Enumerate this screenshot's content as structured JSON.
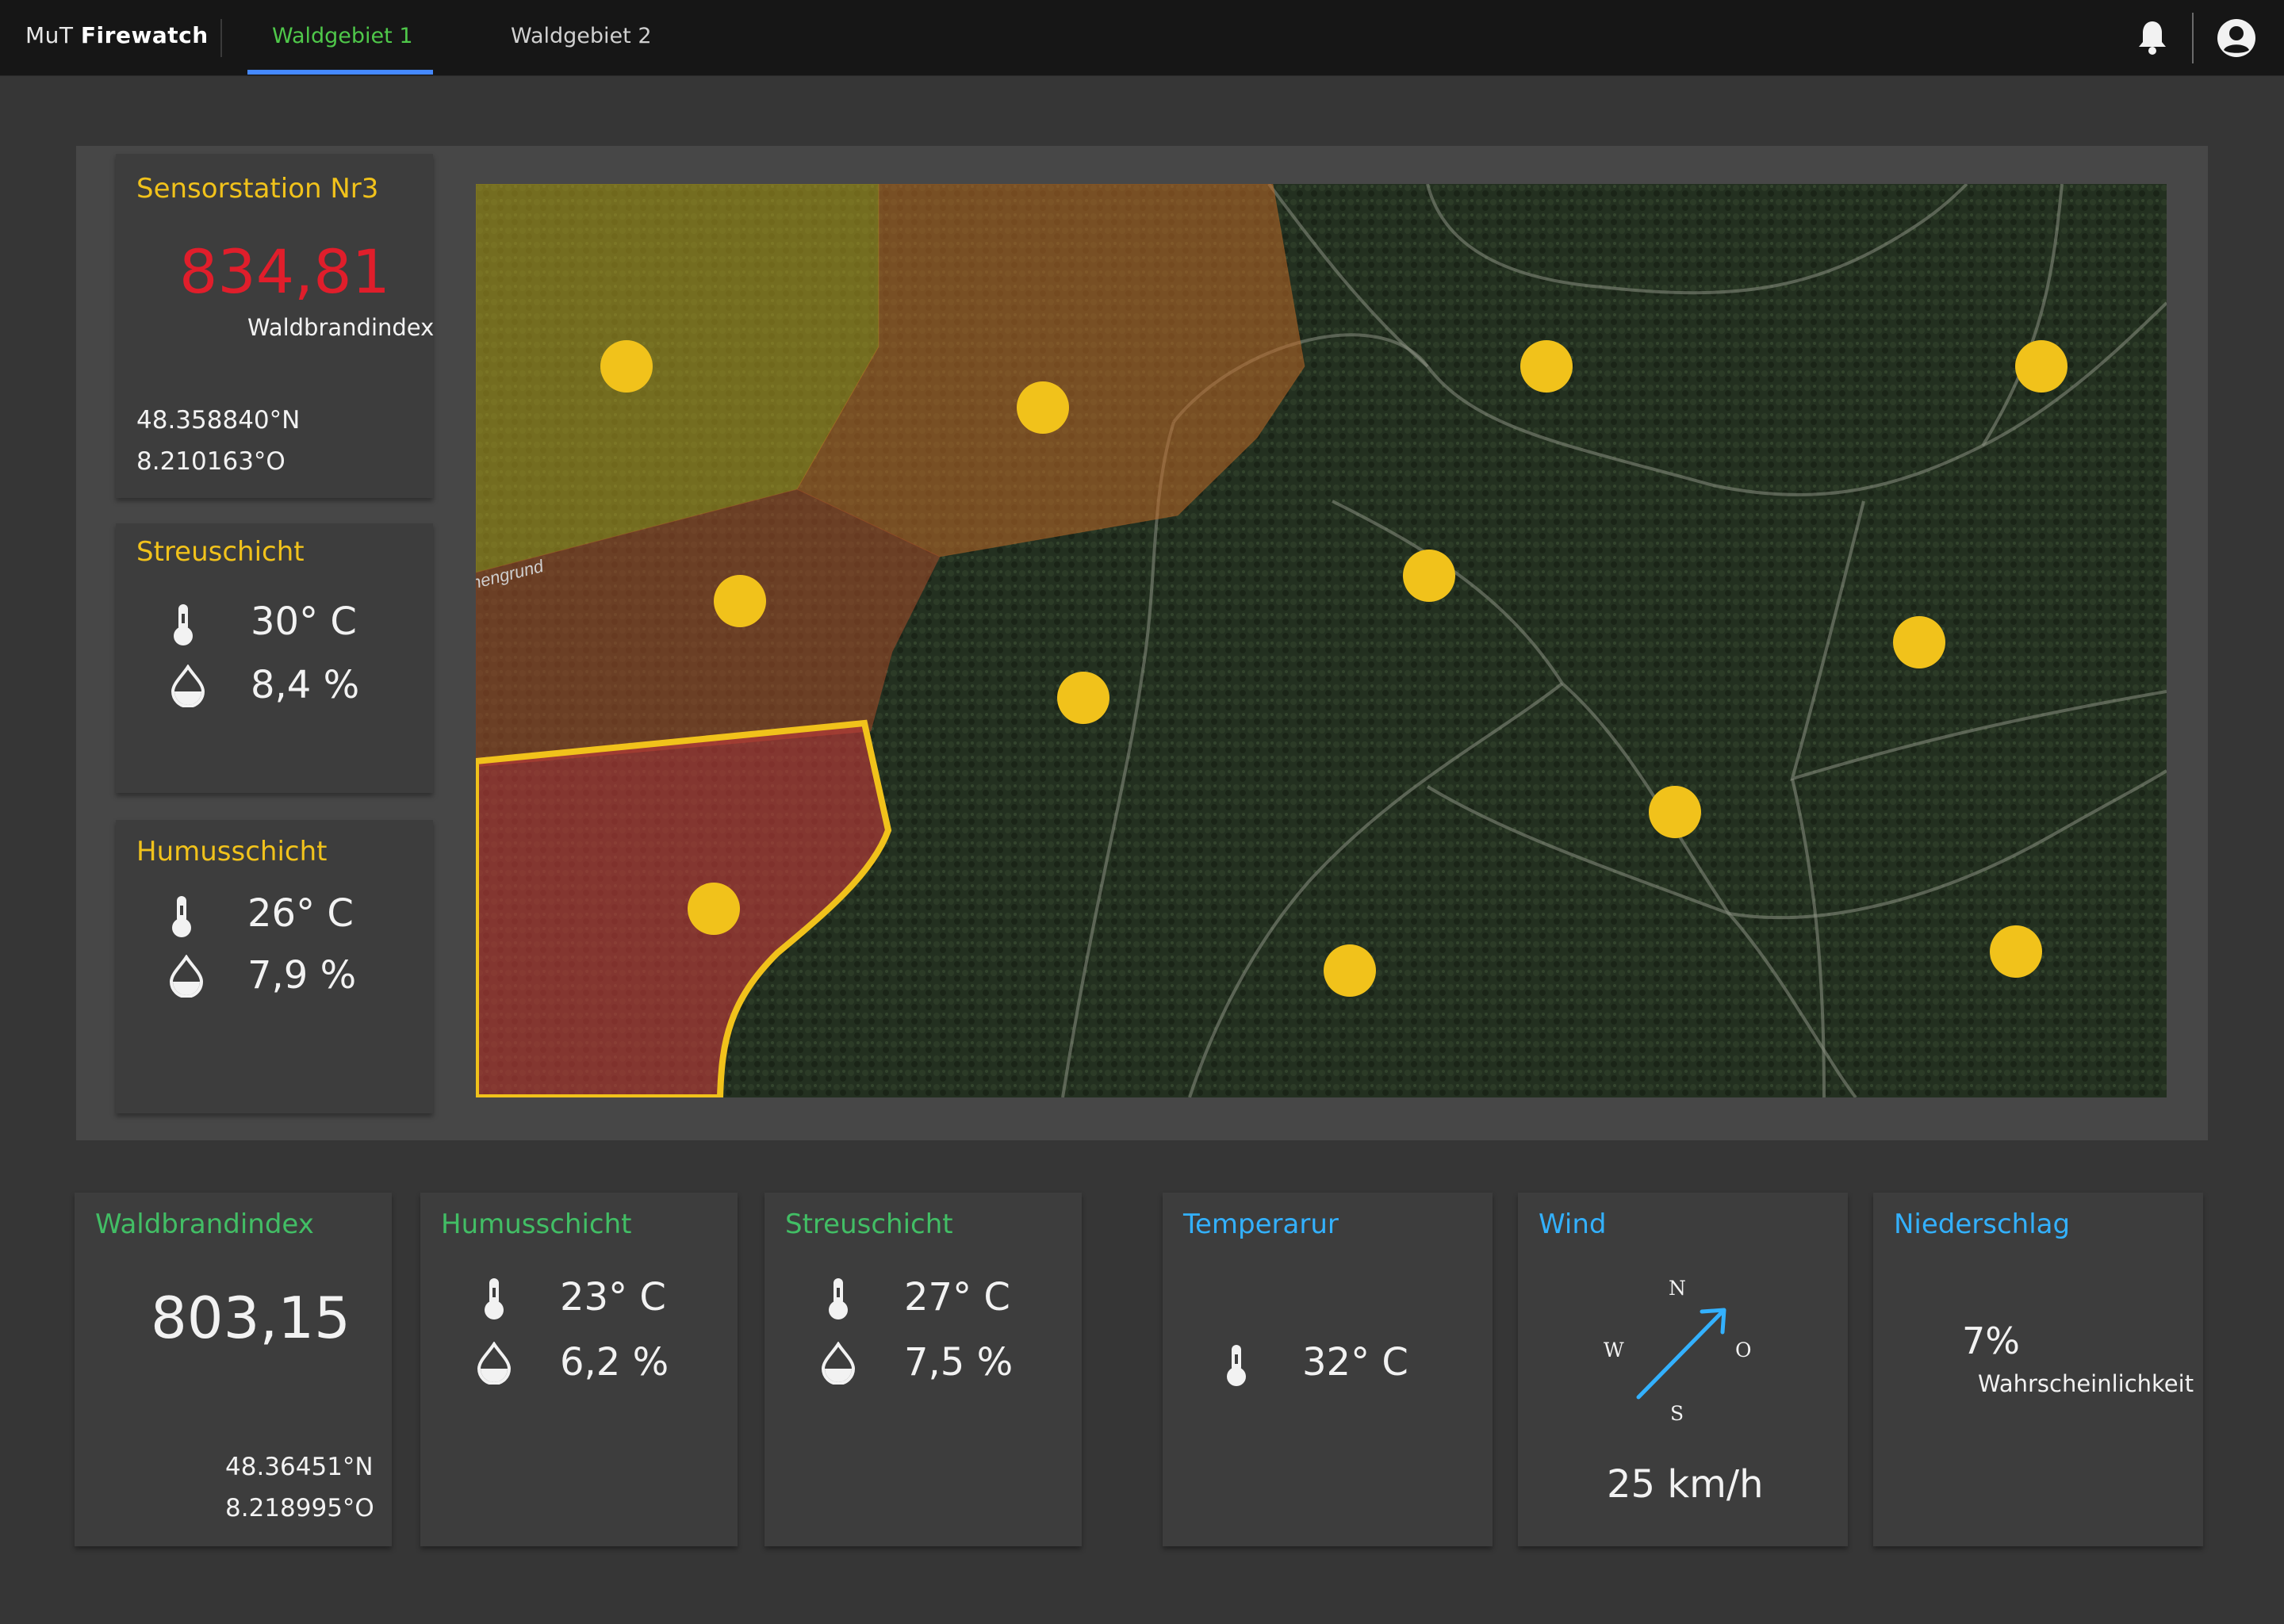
{
  "header": {
    "brand_prefix": "MuT",
    "brand_name": "Firewatch",
    "tabs": [
      {
        "label": "Waldgebiet 1",
        "active": true
      },
      {
        "label": "Waldgebiet 2",
        "active": false
      }
    ],
    "icons": [
      "bell-icon",
      "user-avatar-icon"
    ]
  },
  "station": {
    "title": "Sensorstation Nr3",
    "index_value": "834,81",
    "index_label": "Waldbrandindex",
    "lat": "48.358840°N",
    "lon": "8.210163°O"
  },
  "station_streu": {
    "title": "Streuschicht",
    "temperature": "30° C",
    "humidity": "8,4 %"
  },
  "station_humus": {
    "title": "Humusschicht",
    "temperature": "26° C",
    "humidity": "7,9 %"
  },
  "map": {
    "labels": [
      "nengrund"
    ],
    "zones": [
      {
        "name": "zone-yellow",
        "color": "#b8a020"
      },
      {
        "name": "zone-orange",
        "color": "#c06a28"
      },
      {
        "name": "zone-brown",
        "color": "#a04a2a"
      },
      {
        "name": "zone-red-selected",
        "color": "#c03a3a"
      }
    ],
    "sensor_color": "#f1c21b",
    "selected_border_color": "#f1c21b"
  },
  "summary": {
    "index": {
      "title": "Waldbrandindex",
      "value": "803,15",
      "lat": "48.36451°N",
      "lon": "8.218995°O"
    },
    "humus": {
      "title": "Humusschicht",
      "temperature": "23° C",
      "humidity": "6,2 %"
    },
    "streu": {
      "title": "Streuschicht",
      "temperature": "27° C",
      "humidity": "7,5 %"
    },
    "temperature": {
      "title": "Temperarur",
      "value": "32° C"
    },
    "wind": {
      "title": "Wind",
      "north": "N",
      "south": "S",
      "west": "W",
      "east": "O",
      "speed": "25 km/h"
    },
    "precipitation": {
      "title": "Niederschlag",
      "value": "7%",
      "label": "Wahrscheinlichkeit"
    }
  },
  "colors": {
    "accent_green": "#42be65",
    "accent_yellow": "#f1c21b",
    "accent_cyan": "#33b1ff",
    "alert_red": "#e01e2b",
    "tab_underline": "#4589ff"
  }
}
